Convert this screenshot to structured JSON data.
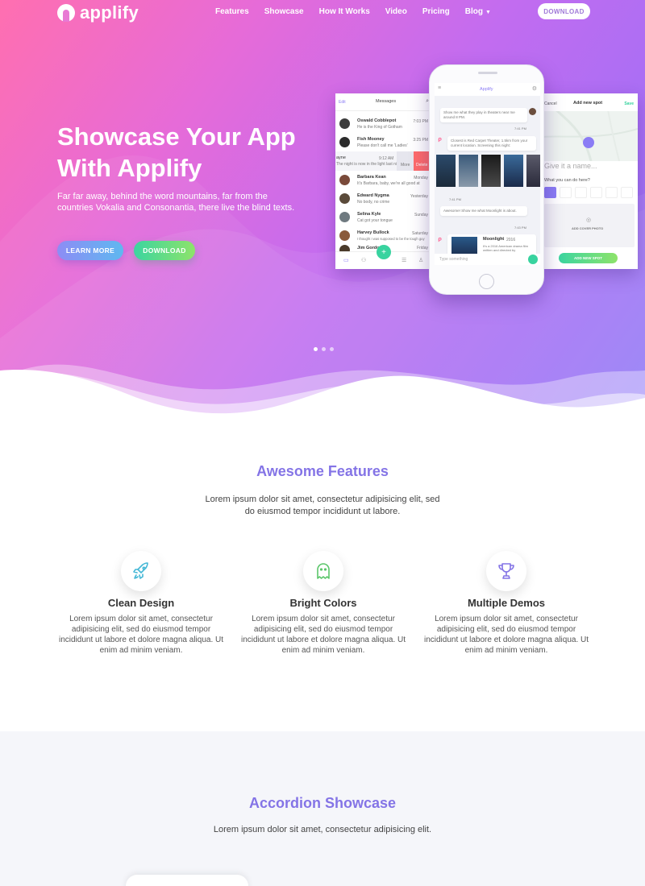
{
  "nav": {
    "logo": "applify",
    "links": [
      "Features",
      "Showcase",
      "How It Works",
      "Video",
      "Pricing",
      "Blog"
    ],
    "download": "DOWNLOAD"
  },
  "hero": {
    "title": "Showcase Your App With Applify",
    "text": "Far far away, behind the word mountains, far from the countries Vokalia and Consonantia, there live the blind texts.",
    "learn_more": "LEARN MORE",
    "download": "DOWNLOAD",
    "active_slide": 1
  },
  "mockup": {
    "messages": {
      "edit": "Edit",
      "title": "Messages",
      "rows": [
        {
          "name": "Oswald Cobblepot",
          "sub": "He is the King of Gotham",
          "time": "7:03 PM"
        },
        {
          "name": "Fish Mooney",
          "sub": "Please don't call me 'Ladies'",
          "time": "3:25 PM"
        },
        {
          "name": "ayne",
          "sub": "The night is now in the light last night",
          "time": "9:12 AM"
        },
        {
          "name": "Barbara Kean",
          "sub": "It's Barbara, baby, we're all good at",
          "time": "Monday"
        },
        {
          "name": "Edward Nygma",
          "sub": "No body, no crime",
          "time": "Yesterday"
        },
        {
          "name": "Selina Kyle",
          "sub": "Cat got your tongue",
          "time": "Sunday"
        },
        {
          "name": "Harvey Bullock",
          "sub": "I thought I was supposed to be the tough guy",
          "time": "Saturday"
        },
        {
          "name": "Jim Gordon",
          "sub": "Everything is under control",
          "time": "Friday"
        }
      ],
      "more": "More",
      "delete": "Delete"
    },
    "phone": {
      "title": "Applify",
      "bubble1": "Show me what they play in theaters near me around 8 PM.",
      "time1": "7:41 PM",
      "bubble2": "Closest is Red Carpet Theater, 1.5km from your current location. Screening this night:",
      "time2": "7:41 PM",
      "bubble3": "Awesome! Show me what Moonlight is about.",
      "time3": "7:43 PM",
      "movie_title": "Moonlight",
      "movie_year": "2016",
      "movie_desc": "It's a 2016 American drama film written and directed by",
      "input_placeholder": "Type something"
    },
    "spot": {
      "cancel": "Cancel",
      "title": "Add new spot",
      "save": "Save",
      "name_placeholder": "Give it a name...",
      "question": "What you can do here?",
      "cover": "ADD COVER PHOTO",
      "button": "ADD NEW SPOT"
    }
  },
  "features": {
    "title": "Awesome Features",
    "subtitle": "Lorem ipsum dolor sit amet, consectetur adipisicing elit, sed do eiusmod tempor incididunt ut labore.",
    "items": [
      {
        "icon": "rocket-icon",
        "title": "Clean Design",
        "text": "Lorem ipsum dolor sit amet, consectetur adipisicing elit, sed do eiusmod tempor incididunt ut labore et dolore magna aliqua. Ut enim ad minim veniam."
      },
      {
        "icon": "ghost-icon",
        "title": "Bright Colors",
        "text": "Lorem ipsum dolor sit amet, consectetur adipisicing elit, sed do eiusmod tempor incididunt ut labore et dolore magna aliqua. Ut enim ad minim veniam."
      },
      {
        "icon": "trophy-icon",
        "title": "Multiple Demos",
        "text": "Lorem ipsum dolor sit amet, consectetur adipisicing elit, sed do eiusmod tempor incididunt ut labore et dolore magna aliqua. Ut enim ad minim veniam."
      }
    ]
  },
  "accordion": {
    "title": "Accordion Showcase",
    "subtitle": "Lorem ipsum dolor sit amet, consectetur adipisicing elit."
  },
  "colors": {
    "accent": "#8474e6",
    "green": "#38d39f",
    "hero_start": "#ff6fb0",
    "hero_end": "#8f7af7"
  }
}
